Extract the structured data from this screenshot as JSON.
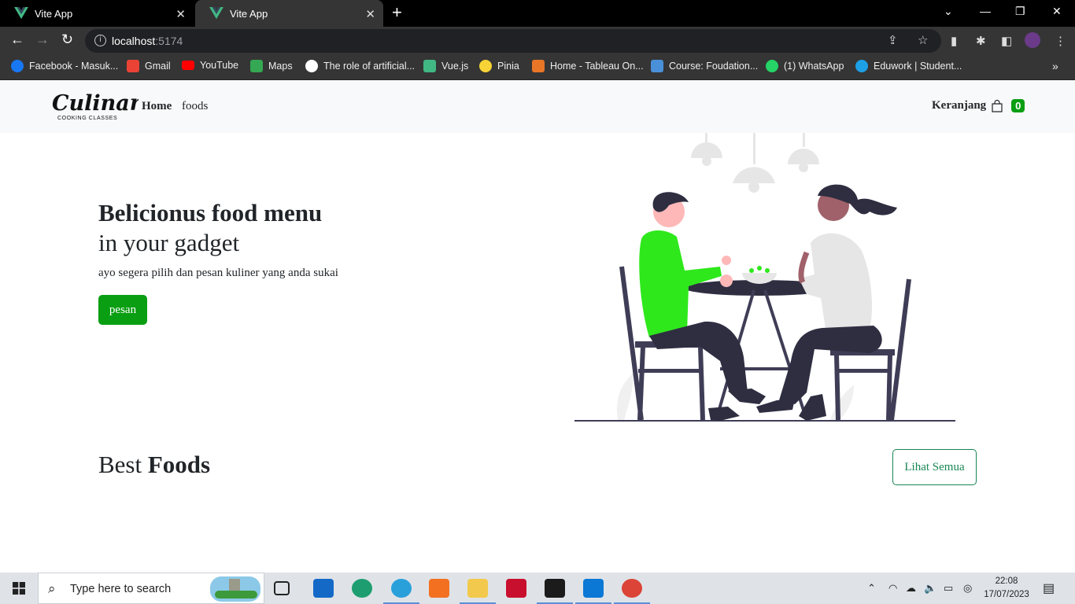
{
  "browser": {
    "tabs": [
      {
        "title": "Vite App"
      },
      {
        "title": "Vite App"
      }
    ],
    "url_host": "localhost",
    "url_port": ":5174",
    "bookmarks": [
      {
        "label": "Facebook - Masuk...",
        "icon": "facebook-icon",
        "color": "#1877f2"
      },
      {
        "label": "Gmail",
        "icon": "gmail-icon",
        "color": "#ea4335"
      },
      {
        "label": "YouTube",
        "icon": "youtube-icon",
        "color": "#ff0000"
      },
      {
        "label": "Maps",
        "icon": "maps-icon",
        "color": "#34a853"
      },
      {
        "label": "The role of artificial...",
        "icon": "notion-icon",
        "color": "#ffffff"
      },
      {
        "label": "Vue.js",
        "icon": "vue-icon",
        "color": "#41b883"
      },
      {
        "label": "Pinia",
        "icon": "pinia-icon",
        "color": "#f7d336"
      },
      {
        "label": "Home - Tableau On...",
        "icon": "tableau-icon",
        "color": "#e97627"
      },
      {
        "label": "Course: Foudation...",
        "icon": "course-icon",
        "color": "#4a90d9"
      },
      {
        "label": "(1) WhatsApp",
        "icon": "whatsapp-icon",
        "color": "#25d366"
      },
      {
        "label": "Eduwork | Student...",
        "icon": "eduwork-icon",
        "color": "#1ea0e6"
      }
    ]
  },
  "navbar": {
    "brand_name": "Culinary",
    "brand_tagline": "COOKING CLASSES",
    "links": {
      "home": "Home",
      "foods": "foods"
    },
    "cart_label": "Keranjang",
    "cart_count": "0"
  },
  "hero": {
    "title": "Belicionus food menu",
    "subtitle": "in your gadget",
    "text": "ayo segera pilih dan pesan kuliner yang anda sukai",
    "button": "pesan"
  },
  "best": {
    "title_light": "Best",
    "title_bold": "Foods",
    "button": "Lihat Semua"
  },
  "taskbar": {
    "search_placeholder": "Type here to search",
    "time": "22:08",
    "date": "17/07/2023"
  },
  "colors": {
    "accent_green": "#0a9e12",
    "outline_green": "#198754",
    "navbar_bg": "#f8f9fa",
    "browser_dark": "#353535"
  }
}
